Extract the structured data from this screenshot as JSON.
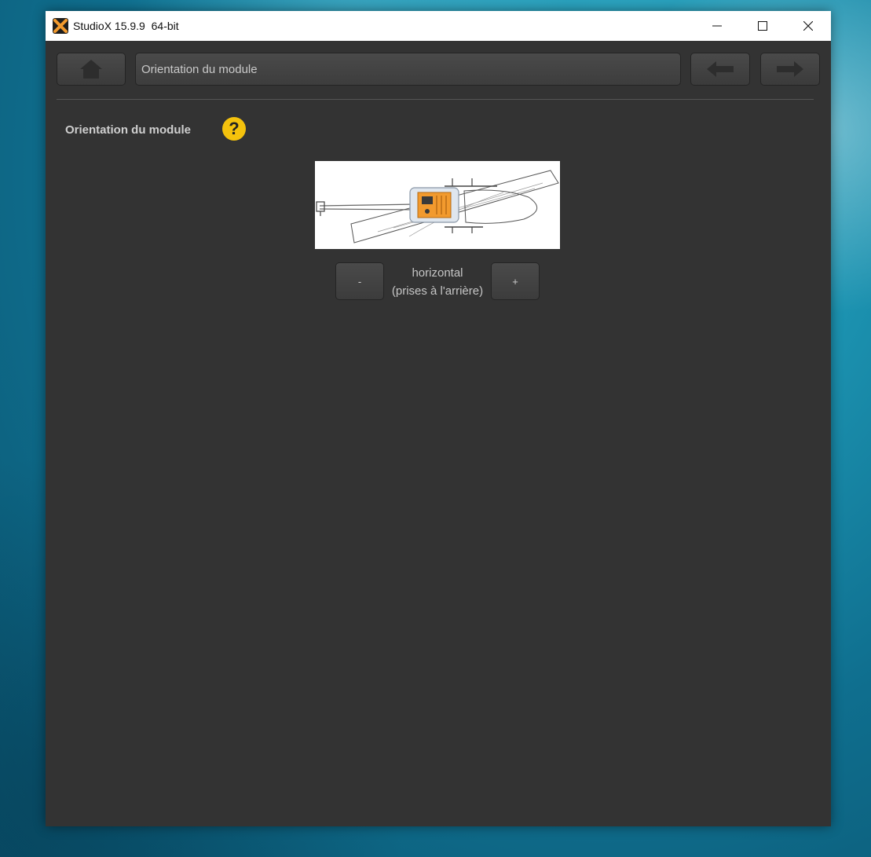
{
  "window": {
    "title": "StudioX 15.9.9  64-bit"
  },
  "toolbar": {
    "path": "Orientation du module"
  },
  "section": {
    "title": "Orientation du module",
    "help_symbol": "?"
  },
  "orientation": {
    "line1": "horizontal",
    "line2": "(prises à l'arrière)",
    "minus_label": "-",
    "plus_label": "+"
  },
  "icons": [
    "studiox-app-icon",
    "minimize-icon",
    "maximize-icon",
    "close-icon",
    "home-icon",
    "arrow-left-icon",
    "arrow-right-icon",
    "help-icon"
  ],
  "colors": {
    "window_bg": "#333333",
    "accent_help": "#f4c20d",
    "module_orange": "#f29a2e"
  }
}
